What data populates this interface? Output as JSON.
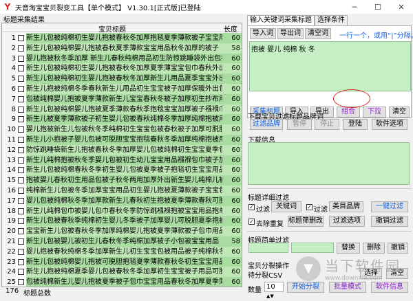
{
  "window": {
    "title": "天音淘宝宝贝裂变工具【单个模式】 V1.30.1[正式版]已登陆"
  },
  "left": {
    "group_title": "标题采集结果",
    "col_title": "宝贝标题",
    "col_len": "长度",
    "rows": [
      {
        "n": "1",
        "title": "新生儿包被纯棉初生婴儿抱被春秋冬加厚抱毯夏季薄款被子宝宝用品",
        "len": "60"
      },
      {
        "n": "2",
        "title": "新生儿包被纯棉婴儿抱被春秋夏季薄款宝宝用品秋冬加厚的被子",
        "len": "58"
      },
      {
        "n": "3",
        "title": "婴儿抱被秋冬季加厚  新生儿春秋纯棉用品初生防惊跳睡袋外出包被",
        "len": "60"
      },
      {
        "n": "4",
        "title": "新生儿包被纯棉初生婴儿抱被春秋冬加厚夏季薄宝宝包巾春秋外出襁褓",
        "len": "60"
      },
      {
        "n": "5",
        "title": "新生儿包被纯棉初生婴儿抱被春秋冬加厚新生儿用品夏季宝宝外出包被",
        "len": "60"
      },
      {
        "n": "6",
        "title": "新生儿抱被纯棉冬季春秋新生儿用品初生宝宝被子加厚保暖外出包被",
        "len": "60"
      },
      {
        "n": "7",
        "title": "包被纯棉婴儿抱被夏季薄款新生儿宝宝春秋冬被子加厚初生抄布用品",
        "len": "60"
      },
      {
        "n": "8",
        "title": "新生儿包被纯棉婴儿抱被夏季薄款春秋季抱毯宝宝加厚被子襁褓巾宝宝用品",
        "len": "60"
      },
      {
        "n": "9",
        "title": "新生儿被夏季薄款被子初生婴儿包被春秋纯棉冬季加厚纯棉抱被用品",
        "len": "60"
      },
      {
        "n": "10",
        "title": "婴儿抱被新生儿包被秋冬季纯棉初生宝宝包被春秋被子加厚可脱胆用品",
        "len": "60"
      },
      {
        "n": "11",
        "title": "新生儿小抱被子婴儿包被可脱胆宝宝抱毯春秋冬季加厚纯棉抱被用品",
        "len": "60"
      },
      {
        "n": "12",
        "title": "防惊跳睡袋新生儿抱被春秋冬季加厚婴儿包被纯棉初生宝宝夏季包被",
        "len": "60"
      },
      {
        "n": "13",
        "title": "新生儿纯棉抱被秋冬季婴儿包被初生幼儿宝宝用品襁褓包巾被子加厚",
        "len": "60"
      },
      {
        "n": "14",
        "title": "新生儿包被纯棉春秋冬季初生婴儿包被夏季被子抱毯初生宝宝用品被子",
        "len": "60"
      },
      {
        "n": "15",
        "title": "抱被婴儿春秋初生用品包被子秋冬两用加厚外出新生婴儿纯棉儿被抱",
        "len": "60"
      },
      {
        "n": "16",
        "title": "纯棉新生儿包被冬季加厚宝宝用品初生婴儿抱被夏薄款被子宝宝包被",
        "len": "60"
      },
      {
        "n": "17",
        "title": "婴儿包被纯棉秋冬季加厚款新生儿春秋初生抱被夏季薄款春秋可脱胆",
        "len": "60"
      },
      {
        "n": "18",
        "title": "新生儿纯棉包巾被婴儿包巾春秋冬季防惊跳襁褓抱被宝宝用品抱单被",
        "len": "60"
      },
      {
        "n": "19",
        "title": "新生儿包被春秋季纯棉初生婴儿冬季被子加厚婴儿可脱胆夏季抱被春",
        "len": "60"
      },
      {
        "n": "20",
        "title": "宝宝新生儿包被春秋冬季加厚纯棉婴儿抱被夏季薄款被子包巾用品",
        "len": "60"
      },
      {
        "n": "21",
        "title": "新生儿包被婴儿被初生儿春秋冬季纯棉加厚被子小包被宝宝用品",
        "len": "58"
      },
      {
        "n": "22",
        "title": "婴儿抱被春秋纯棉冬季加厚新生儿初生宝宝包被用品被子纯棉秋冬包被",
        "len": "60"
      },
      {
        "n": "23",
        "title": "新生儿包被纯棉婴儿抱被可脱胆抱毯夏季薄款春秋冬初生宝宝用品",
        "len": "60"
      },
      {
        "n": "24",
        "title": "新生儿抱被纯棉夏季婴儿包被春秋冬季加厚初生宝宝被子用品可脱胆",
        "len": "60"
      },
      {
        "n": "25",
        "title": "包被纯棉新生儿婴儿抱被夏季被子包巾宝宝用品春秋冬加厚夏季薄款",
        "len": "60"
      }
    ],
    "count": "176",
    "count_label": "标题总数"
  },
  "right": {
    "tab_active": "输入关键词采集标题",
    "tab_inactive": "选择条件",
    "btn_import_words": "导入词",
    "btn_export_words": "导出词",
    "btn_clear_words": "清空词",
    "hint": "一行一个，或用“|”分隔。",
    "keywords": "抱被 婴儿 纯棉 秋 冬",
    "btn_collect": "采集标题",
    "btn_import": "导入",
    "btn_export": "导出",
    "btn_combine": "组合",
    "btn_dropdown": "下拉",
    "btn_clear": "清空",
    "sec_download": "下载宝贝过滤标题品牌词",
    "btn_filter_brand": "过滤品牌",
    "btn_pause": "暂停",
    "btn_stop": "停止",
    "btn_login": "登陆",
    "btn_software_opts": "软件选项",
    "sec_download_info": "下载信息",
    "sec_detail_filter": "标题详细过滤",
    "chk_filter1": "过滤",
    "btn_keyword": "关键词",
    "chk_filter2": "过滤",
    "btn_category_brand": "类目品牌",
    "btn_one_key": "一键过滤",
    "chk_dedupe": "去除重复",
    "btn_title_delete": "标题筛删改",
    "btn_filter_opts": "过滤选项",
    "btn_undo_filter": "撤销过滤",
    "sec_simple_filter": "标题简单过滤",
    "btn_replace": "替换",
    "btn_delete": "删除",
    "btn_undo": "撤销",
    "sec_split": "宝贝分裂操作",
    "split_csv_label": "待分裂CSV",
    "btn_select": "选择",
    "btn_clear2": "清空",
    "qty_label": "数量",
    "qty_value": "10",
    "btn_start_split": "开始分裂",
    "btn_batch": "批量模式",
    "btn_software_info": "软件信息"
  },
  "watermark": {
    "cn": "当下软件园",
    "en": "www.downxia.com"
  }
}
